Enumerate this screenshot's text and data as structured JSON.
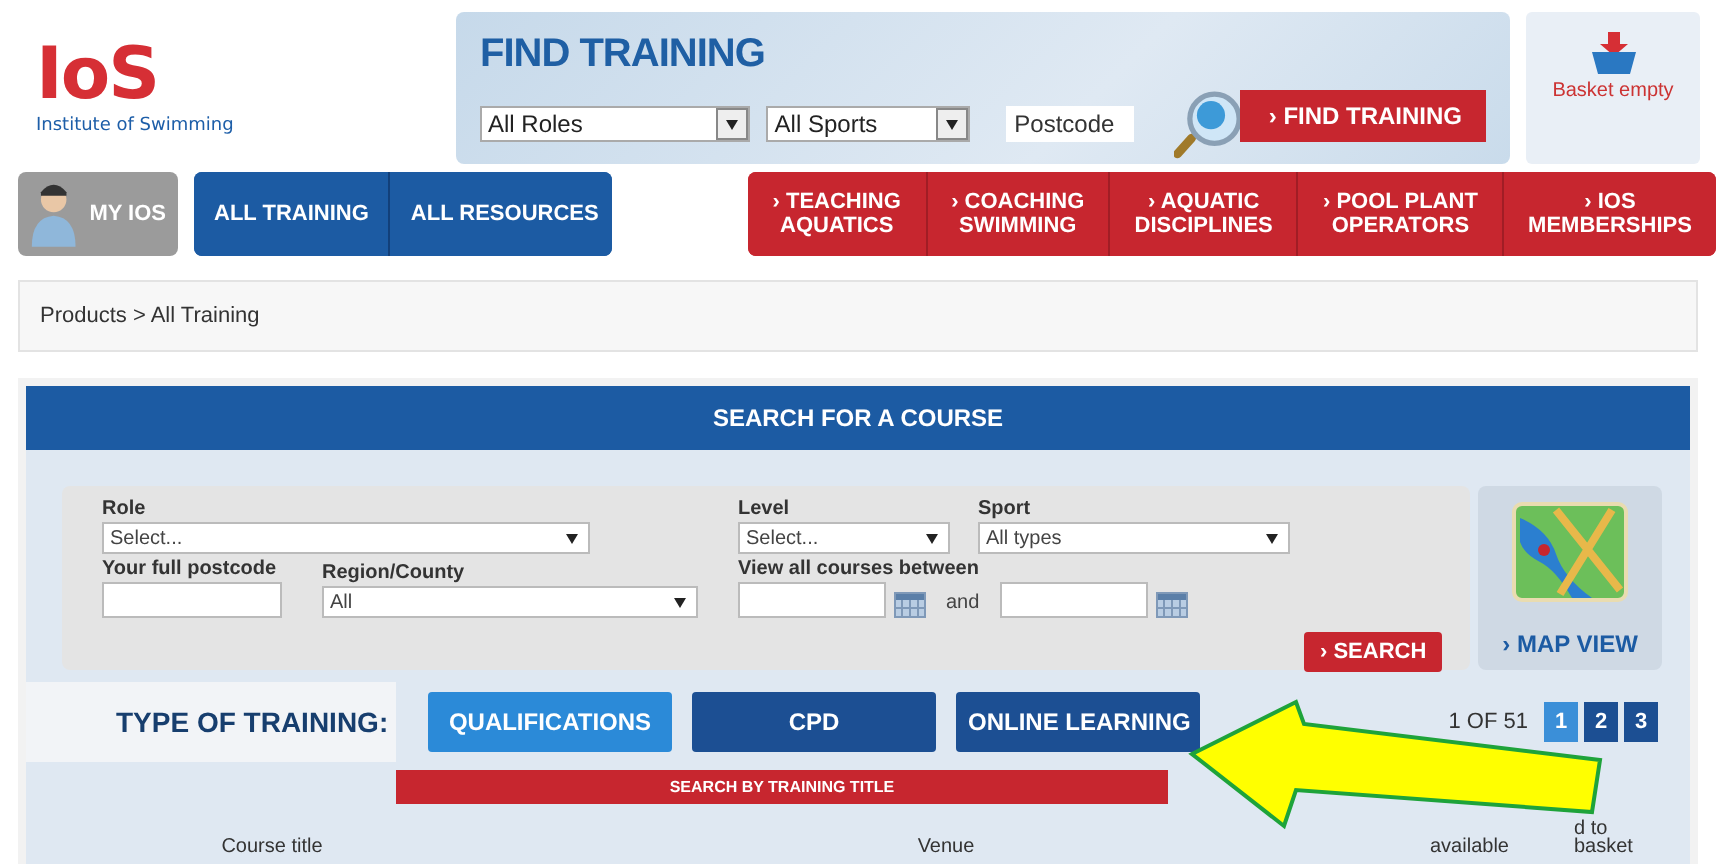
{
  "logo": {
    "letters": "IoS",
    "tagline": "Institute of Swimming"
  },
  "find_training": {
    "title": "FIND TRAINING",
    "role_select": "All Roles",
    "sport_select": "All Sports",
    "postcode": {
      "placeholder": "Postcode"
    },
    "button": "› FIND TRAINING"
  },
  "basket": {
    "label": "Basket empty"
  },
  "nav": {
    "my_ios": "MY IOS",
    "main": [
      {
        "label": "ALL TRAINING"
      },
      {
        "label": "ALL RESOURCES"
      }
    ],
    "categories": [
      {
        "label": "› TEACHING\nAQUATICS"
      },
      {
        "label": "› COACHING\nSWIMMING"
      },
      {
        "label": "› AQUATIC\nDISCIPLINES"
      },
      {
        "label": "› POOL PLANT\nOPERATORS"
      },
      {
        "label": "› IOS\nMEMBERSHIPS"
      }
    ]
  },
  "breadcrumb": "Products > All Training",
  "search": {
    "title": "SEARCH FOR A COURSE",
    "role": {
      "label": "Role",
      "value": "Select..."
    },
    "level": {
      "label": "Level",
      "value": "Select..."
    },
    "sport": {
      "label": "Sport",
      "value": "All types"
    },
    "postcode": {
      "label": "Your full postcode"
    },
    "region": {
      "label": "Region/County",
      "value": "All"
    },
    "dates": {
      "label": "View all courses between",
      "joiner": "and"
    },
    "search_button": "› SEARCH",
    "map_button": "› MAP VIEW"
  },
  "training": {
    "label": "TYPE OF TRAINING:",
    "tabs": [
      {
        "label": "QUALIFICATIONS",
        "selected": true
      },
      {
        "label": "CPD",
        "selected": false
      },
      {
        "label": "ONLINE LEARNING",
        "selected": false
      }
    ],
    "title_search": "SEARCH BY TRAINING TITLE",
    "page_info": "1 OF 51",
    "pages": [
      {
        "label": "1",
        "selected": true
      },
      {
        "label": "2",
        "selected": false
      },
      {
        "label": "3",
        "selected": false
      }
    ],
    "columns": [
      "Course title",
      "Venue",
      "available",
      "d to\nbasket"
    ]
  },
  "annotation": {
    "kind": "arrow"
  }
}
